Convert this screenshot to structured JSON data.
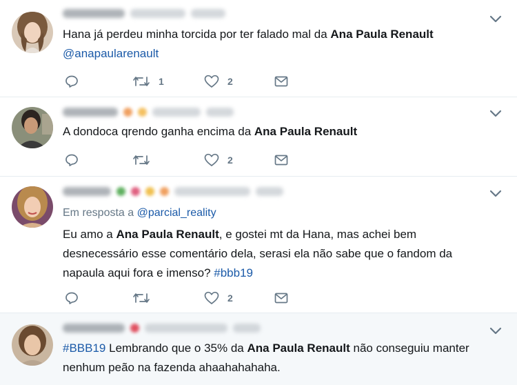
{
  "tweets": [
    {
      "replying_prefix": "",
      "replying_handle": "",
      "segments": [
        {
          "t": "Hana já perdeu minha torcida por ter falado mal da ",
          "s": "n"
        },
        {
          "t": "Ana Paula Renault",
          "s": "b"
        },
        {
          "t": " ",
          "s": "n"
        },
        {
          "t": "@anapaularenault",
          "s": "l"
        }
      ],
      "reply_count": "",
      "retweet_count": "1",
      "like_count": "2"
    },
    {
      "replying_prefix": "",
      "replying_handle": "",
      "segments": [
        {
          "t": "A dondoca qrendo ganha encima da ",
          "s": "n"
        },
        {
          "t": "Ana Paula Renault",
          "s": "b"
        }
      ],
      "reply_count": "",
      "retweet_count": "",
      "like_count": "2"
    },
    {
      "replying_prefix": "Em resposta a ",
      "replying_handle": "@parcial_reality",
      "segments": [
        {
          "t": "Eu amo a ",
          "s": "n"
        },
        {
          "t": "Ana Paula Renault",
          "s": "b"
        },
        {
          "t": ", e gostei mt da Hana, mas achei bem desnecessário esse comentário dela, serasi ela não sabe que o fandom da napaula aqui fora e imenso? ",
          "s": "n"
        },
        {
          "t": "#bbb19",
          "s": "l"
        }
      ],
      "reply_count": "",
      "retweet_count": "",
      "like_count": "2"
    },
    {
      "replying_prefix": "",
      "replying_handle": "",
      "segments": [
        {
          "t": "#BBB19",
          "s": "l"
        },
        {
          "t": " Lembrando que o 35% da ",
          "s": "n"
        },
        {
          "t": "Ana Paula Renault",
          "s": "b"
        },
        {
          "t": " não conseguiu manter nenhum peão na fazenda ahaahahahaha.",
          "s": "n"
        }
      ],
      "reply_count": "",
      "retweet_count": "",
      "like_count": ""
    }
  ],
  "icons": {
    "reply": "reply-bubble-icon",
    "retweet": "retweet-arrows-icon",
    "like": "heart-outline-icon",
    "dm": "envelope-icon",
    "menu": "chevron-down-icon"
  },
  "colors": {
    "text": "#14171a",
    "secondary": "#657786",
    "link": "#1b5aa8",
    "divider": "#e6ecf0",
    "highlight_bg": "#f5f8fa"
  }
}
